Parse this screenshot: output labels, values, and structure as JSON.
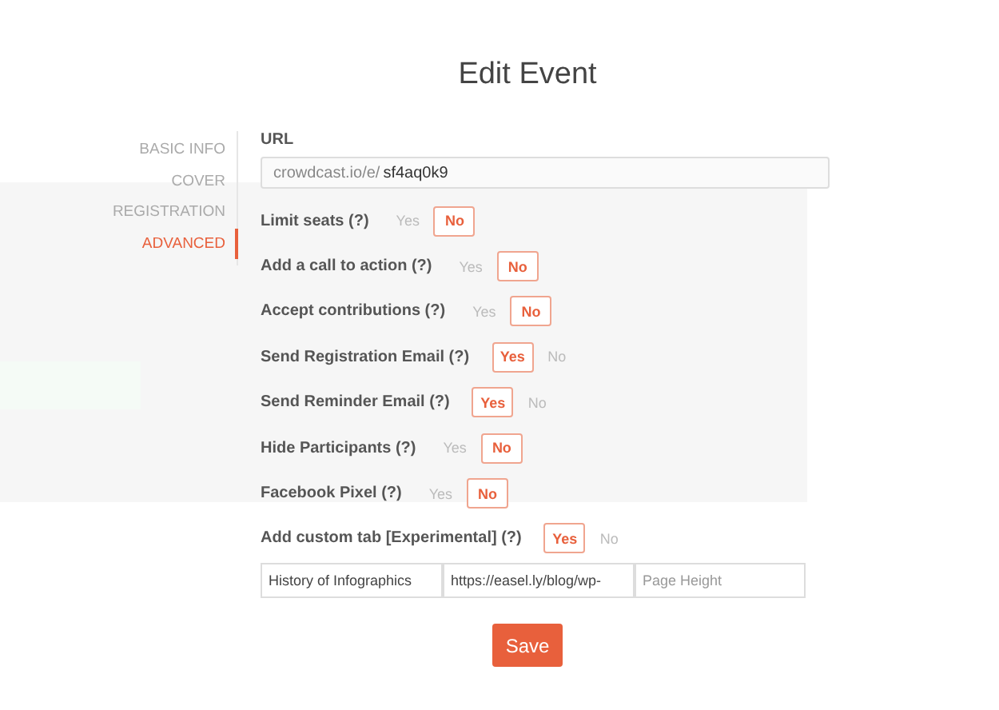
{
  "modal": {
    "title": "Edit Event",
    "nav": [
      {
        "label": "BASIC INFO",
        "selected": false
      },
      {
        "label": "COVER",
        "selected": false
      },
      {
        "label": "REGISTRATION",
        "selected": false
      },
      {
        "label": "ADVANCED",
        "selected": true
      }
    ],
    "url_label": "URL",
    "url_prefix": "crowdcast.io/e/",
    "url_value": "sf4aq0k9",
    "settings": [
      {
        "label": "Limit seats (?)",
        "options": [
          {
            "label": "Yes",
            "selected": false
          },
          {
            "label": "No",
            "selected": true
          }
        ]
      },
      {
        "label": "Add a call to action (?)",
        "options": [
          {
            "label": "Yes",
            "selected": false
          },
          {
            "label": "No",
            "selected": true
          }
        ]
      },
      {
        "label": "Accept contributions (?)",
        "options": [
          {
            "label": "Yes",
            "selected": false
          },
          {
            "label": "No",
            "selected": true
          }
        ]
      },
      {
        "label": "Send Registration Email (?)",
        "options": [
          {
            "label": "Yes",
            "selected": true
          },
          {
            "label": "No",
            "selected": false
          }
        ]
      },
      {
        "label": "Send Reminder Email (?)",
        "options": [
          {
            "label": "Yes",
            "selected": true
          },
          {
            "label": "No",
            "selected": false
          }
        ]
      },
      {
        "label": "Hide Participants (?)",
        "options": [
          {
            "label": "Yes",
            "selected": false
          },
          {
            "label": "No",
            "selected": true
          }
        ]
      },
      {
        "label": "Facebook Pixel (?)",
        "options": [
          {
            "label": "Yes",
            "selected": false
          },
          {
            "label": "No",
            "selected": true
          }
        ]
      },
      {
        "label": "Add custom tab [Experimental] (?)",
        "options": [
          {
            "label": "Yes",
            "selected": true
          },
          {
            "label": "No",
            "selected": false
          }
        ]
      }
    ],
    "custom_tab": {
      "name_value": "History of Infographics",
      "url_value": "https://easel.ly/blog/wp-",
      "height_placeholder": "Page Height"
    },
    "save_button": "Save"
  }
}
